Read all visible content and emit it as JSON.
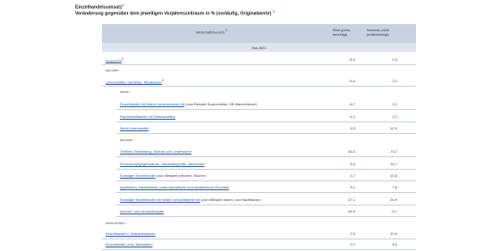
{
  "page": {
    "title": "Einzelhandelsumsatz",
    "title_sup": "1",
    "subtitle": "Veränderung gegenüber dem jeweiligen Vorjahreszeitraum in % (vorläufig, Originalwerte)",
    "subtitle_sup": "2"
  },
  "table": {
    "header": {
      "col1": "Wirtschaftsbereich",
      "col1_sup": "3",
      "col2": "Real (preis-bereinigt)",
      "col3": "Nominal (nicht preisbereinigt)"
    },
    "period": "Mai 2022",
    "rows": [
      {
        "label": "Insgesamt",
        "sup": "4",
        "real": "-8,4",
        "nominal": "0,3"
      },
      {
        "section": "darunter:"
      },
      {
        "label": "Lebensmittel, Getränke, Tabakwaren",
        "sup": "5",
        "real": "-6,4",
        "nominal": "2,2"
      },
      {
        "section": "davon:"
      },
      {
        "label": "Einzelhandel mit Waren verschiedener Art",
        "suffix": " (zum Beispiel Supermärkte, SB-Warenhäuser)",
        "real": "-6,7",
        "nominal": "2,2"
      },
      {
        "label": "Facheinzelhandel mit Lebensmitteln",
        "real": "-4,1",
        "nominal": "2,2"
      },
      {
        "label": "Nicht-Lebensmittel",
        "real": "5,3",
        "nominal": "12,9"
      },
      {
        "section": "darunter:"
      },
      {
        "label": "Textilien, Bekleidung, Schuhe und Lederwaren",
        "real": "63,3",
        "nominal": "73,7"
      },
      {
        "label": "Einrichtungsgegenstände, Haushaltsgeräte, Baubedarf",
        "real": "8,4",
        "nominal": "18,7"
      },
      {
        "label": "Sonstiger Einzelhandel",
        "suffix": " (zum Beispiel Intenden, Bücher)",
        "real": "1,7",
        "nominal": "10,8"
      },
      {
        "label": "Apotheken, kosmetische, pharmazeutische und medizinische Produkte",
        "real": "5,1",
        "nominal": "7,8"
      },
      {
        "label": "Sonstiger Einzelhandel mit Waren verschiedener Art",
        "suffix": " (zum Beispiel Waren- und Kaufhäuser)",
        "real": "27,1",
        "nominal": "34,9"
      },
      {
        "label": "Internet- und Versandhandel",
        "real": "-16,9",
        "nominal": "-9,7"
      },
      {
        "section": "nachrichtlich:"
      },
      {
        "label": "Einzelhandel in Verkaufsräumen",
        "real": "2,9",
        "nominal": "10,9"
      },
      {
        "label": "Einzelhandel ohne Tankstellen",
        "real": "0,7",
        "nominal": "8,9"
      }
    ]
  },
  "colors": {
    "header_bg": "#c7d3e2",
    "subheader_bg": "#dde5ee",
    "link": "#2b5e9e",
    "row_line": "#c5d0dc"
  }
}
